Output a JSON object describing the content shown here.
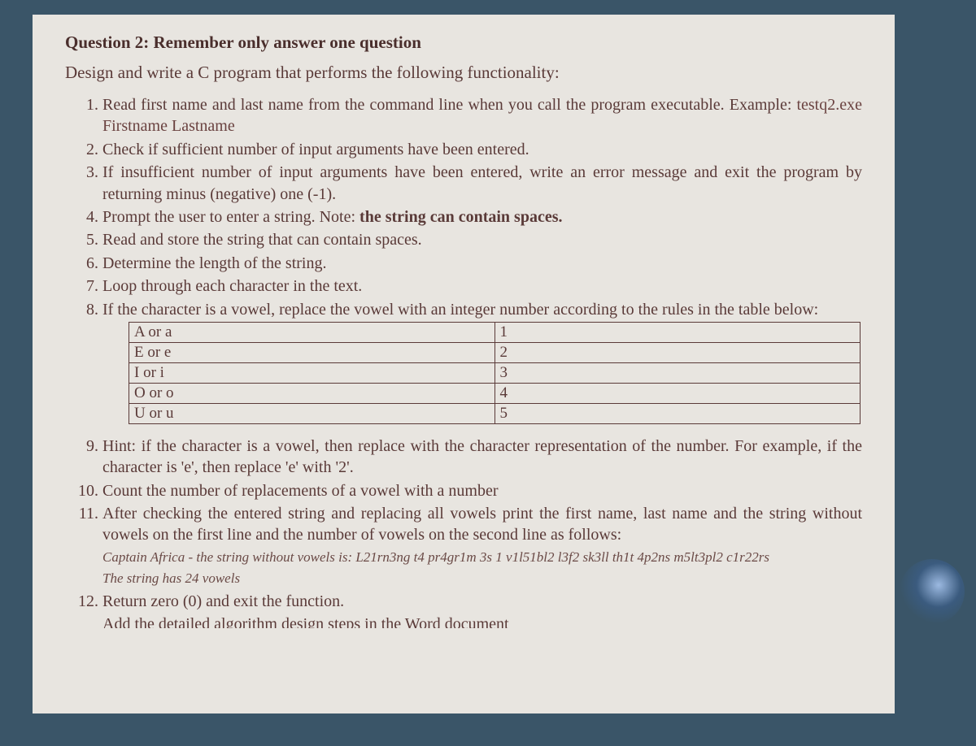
{
  "title": "Question 2: Remember only answer one question",
  "prompt": "Design and write a C program that performs the following functionality:",
  "items1": [
    "Read first name and last name from the command line when you call the program executable. Example: ",
    "Check if sufficient number of input arguments have been entered.",
    "If insufficient number of input arguments have been entered, write an error message and exit the program by returning minus (negative) one (-1).",
    "Prompt the user to enter a string. Note: ",
    "Read and store the string that can contain spaces.",
    "Determine the length of the string.",
    "Loop through each character in the text.",
    "If the character is a vowel, replace the vowel with an integer number according to the rules in the table below:"
  ],
  "example_cmd": "testq2.exe Firstname Lastname",
  "note_bold": "the string can contain spaces.",
  "table": [
    {
      "l": "A or a",
      "r": "1"
    },
    {
      "l": "E or e",
      "r": "2"
    },
    {
      "l": "I or i",
      "r": "3"
    },
    {
      "l": "O or o",
      "r": "4"
    },
    {
      "l": "U or u",
      "r": "5"
    }
  ],
  "items2": {
    "nine": "Hint: if the character is a vowel, then replace with the character representation of the number. For example, if the character is 'e', then replace 'e' with '2'.",
    "ten": "Count the number of replacements of a vowel with a number",
    "eleven": "After checking the entered string and replacing all vowels print the first name, last name and the string without vowels on the first line and the number of vowels on the second line as follows:",
    "eleven_italic1": "Captain Africa - the string without vowels is: L21rn3ng t4 pr4gr1m 3s 1 v1l51bl2 l3f2 sk3ll th1t 4p2ns m5lt3pl2 c1r22rs",
    "eleven_italic2": "The string has 24 vowels",
    "twelve": "Return zero (0) and exit the function.",
    "thirteen_cut": "Add the detailed algorithm design steps in the Word document"
  }
}
